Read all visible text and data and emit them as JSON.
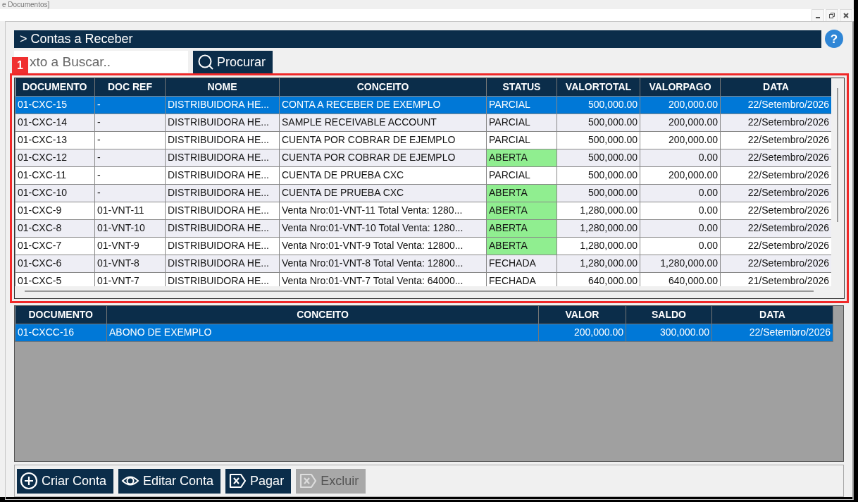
{
  "window": {
    "title": "e Documentos]"
  },
  "help": {
    "label": "?"
  },
  "panel": {
    "title": "> Contas a Receber"
  },
  "search": {
    "placeholder": "xto a Buscar..",
    "button": "Procurar"
  },
  "annotation": {
    "label": "1"
  },
  "accounts_table": {
    "columns": [
      {
        "label": "DOCUMENTO"
      },
      {
        "label": "DOC REF"
      },
      {
        "label": "NOME"
      },
      {
        "label": "CONCEITO"
      },
      {
        "label": "STATUS"
      },
      {
        "label": "VALORTOTAL"
      },
      {
        "label": "VALORPAGO"
      },
      {
        "label": "DATA"
      }
    ],
    "rows": [
      {
        "selected": true,
        "cells": [
          "01-CXC-15",
          "-",
          "DISTRIBUIDORA HE...",
          "CONTA A RECEBER DE EXEMPLO",
          "PARCIAL",
          "500,000.00",
          "200,000.00",
          "22/Setembro/2026"
        ]
      },
      {
        "selected": false,
        "cells": [
          "01-CXC-14",
          "-",
          "DISTRIBUIDORA HE...",
          "SAMPLE RECEIVABLE ACCOUNT",
          "PARCIAL",
          "500,000.00",
          "200,000.00",
          "22/Setembro/2026"
        ]
      },
      {
        "selected": false,
        "cells": [
          "01-CXC-13",
          "-",
          "DISTRIBUIDORA HE...",
          "CUENTA POR COBRAR DE EJEMPLO",
          "PARCIAL",
          "500,000.00",
          "200,000.00",
          "22/Setembro/2026"
        ]
      },
      {
        "selected": false,
        "color": "#90ee90",
        "cells": [
          "01-CXC-12",
          "-",
          "DISTRIBUIDORA HE...",
          "CUENTA POR COBRAR DE EJEMPLO",
          "ABERTA",
          "500,000.00",
          "0.00",
          "22/Setembro/2026"
        ]
      },
      {
        "selected": false,
        "cells": [
          "01-CXC-11",
          "-",
          "DISTRIBUIDORA HE...",
          "CUENTA DE PRUEBA CXC",
          "PARCIAL",
          "500,000.00",
          "200,000.00",
          "22/Setembro/2026"
        ]
      },
      {
        "selected": false,
        "color": "#90ee90",
        "cells": [
          "01-CXC-10",
          "-",
          "DISTRIBUIDORA HE...",
          "CUENTA DE PRUEBA CXC",
          "ABERTA",
          "500,000.00",
          "0.00",
          "22/Setembro/2026"
        ]
      },
      {
        "selected": false,
        "color": "#90ee90",
        "cells": [
          "01-CXC-9",
          "01-VNT-11",
          "DISTRIBUIDORA HE...",
          "Venta Nro:01-VNT-11 Total Venta: 1280...",
          "ABERTA",
          "1,280,000.00",
          "0.00",
          "22/Setembro/2026"
        ]
      },
      {
        "selected": false,
        "color": "#90ee90",
        "cells": [
          "01-CXC-8",
          "01-VNT-10",
          "DISTRIBUIDORA HE...",
          "Venta Nro:01-VNT-10 Total Venta: 1280...",
          "ABERTA",
          "1,280,000.00",
          "0.00",
          "22/Setembro/2026"
        ]
      },
      {
        "selected": false,
        "color": "#90ee90",
        "cells": [
          "01-CXC-7",
          "01-VNT-9",
          "DISTRIBUIDORA HE...",
          "Venta Nro:01-VNT-9 Total Venta: 12800...",
          "ABERTA",
          "1,280,000.00",
          "0.00",
          "22/Setembro/2026"
        ]
      },
      {
        "selected": false,
        "cells": [
          "01-CXC-6",
          "01-VNT-8",
          "DISTRIBUIDORA HE...",
          "Venta Nro:01-VNT-8 Total Venta: 12800...",
          "FECHADA",
          "1,280,000.00",
          "1,280,000.00",
          "22/Setembro/2026"
        ]
      },
      {
        "selected": false,
        "cells": [
          "01-CXC-5",
          "01-VNT-7",
          "DISTRIBUIDORA HE...",
          "Venta Nro:01-VNT-7 Total Venta: 64000...",
          "FECHADA",
          "640,000.00",
          "640,000.00",
          "21/Setembro/2026"
        ]
      }
    ]
  },
  "payments_table": {
    "columns": [
      {
        "label": "DOCUMENTO"
      },
      {
        "label": "CONCEITO"
      },
      {
        "label": "VALOR"
      },
      {
        "label": "SALDO"
      },
      {
        "label": "DATA"
      }
    ],
    "rows": [
      {
        "selected": true,
        "cells": [
          "01-CXCC-16",
          "ABONO DE EXEMPLO",
          "200,000.00",
          "300,000.00",
          "22/Setembro/2026"
        ]
      }
    ]
  },
  "buttons": [
    {
      "label": "Criar Conta",
      "kind": "create",
      "disabled": false
    },
    {
      "label": "Editar Conta",
      "kind": "edit",
      "disabled": false
    },
    {
      "label": "Pagar",
      "kind": "pay",
      "disabled": false
    },
    {
      "label": "Excluir",
      "kind": "delete",
      "disabled": true
    }
  ]
}
